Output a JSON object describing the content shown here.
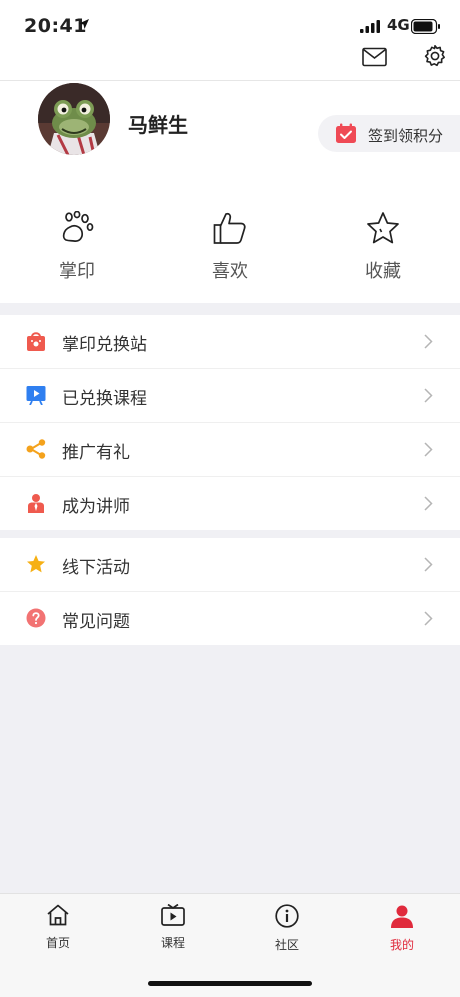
{
  "status_bar": {
    "time": "20:41",
    "network": "4G"
  },
  "profile": {
    "username": "马鲜生",
    "checkin_label": "签到领积分"
  },
  "stats": [
    {
      "label": "掌印",
      "icon": "paw-icon"
    },
    {
      "label": "喜欢",
      "icon": "thumbs-up-icon"
    },
    {
      "label": "收藏",
      "icon": "star-icon"
    }
  ],
  "menu_group_1": [
    {
      "label": "掌印兑换站",
      "icon": "shop-bag-icon"
    },
    {
      "label": "已兑换课程",
      "icon": "play-board-icon"
    },
    {
      "label": "推广有礼",
      "icon": "share-icon"
    },
    {
      "label": "成为讲师",
      "icon": "lecturer-icon"
    }
  ],
  "menu_group_2": [
    {
      "label": "线下活动",
      "icon": "star-badge-icon"
    },
    {
      "label": "常见问题",
      "icon": "question-icon"
    }
  ],
  "tabs": [
    {
      "label": "首页",
      "icon": "home-icon"
    },
    {
      "label": "课程",
      "icon": "tv-play-icon"
    },
    {
      "label": "社区",
      "icon": "info-circle-icon"
    },
    {
      "label": "我的",
      "icon": "user-icon"
    }
  ],
  "colors": {
    "accent": "#e02a3c",
    "checkin_red": "#ef4a55"
  }
}
